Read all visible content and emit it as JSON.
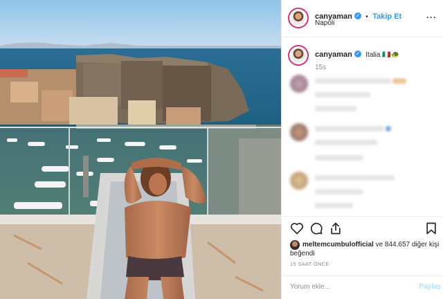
{
  "post": {
    "username": "canyaman",
    "follow_label": "Takip Et",
    "location": "Napoli",
    "caption_user": "canyaman",
    "caption_text": "Italia 🇮🇹🐢",
    "caption_age": "15s",
    "likes_user": "meltemcumbulofficial",
    "likes_rest": "ve 844.657 diğer kişi",
    "likes_suffix": "beğendi",
    "time_ago": "15 SAAT ÖNCE",
    "comment_placeholder": "Yorum ekle...",
    "post_button": "Paylaş"
  },
  "colors": {
    "accent": "#3897f0",
    "story_ring": "#e1306c"
  },
  "icons": [
    "more-options-icon",
    "verified-badge-icon",
    "heart-icon",
    "comment-icon",
    "share-icon",
    "bookmark-icon"
  ]
}
